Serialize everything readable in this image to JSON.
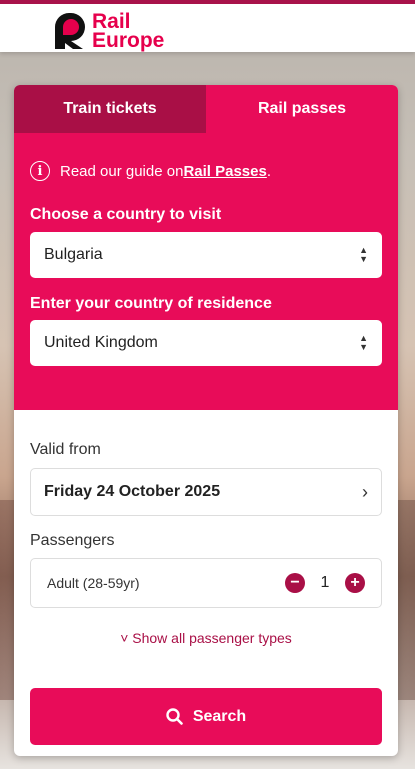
{
  "brand": {
    "line1": "Rail",
    "line2": "Europe",
    "color": "#e6004c"
  },
  "tabs": [
    {
      "label": "Train tickets",
      "active": false
    },
    {
      "label": "Rail passes",
      "active": true
    }
  ],
  "info": {
    "prefix": "Read our guide on ",
    "link": "Rail Passes",
    "suffix": "."
  },
  "country": {
    "label": "Choose a country to visit",
    "value": "Bulgaria"
  },
  "residence": {
    "label": "Enter your country of residence",
    "value": "United Kingdom"
  },
  "valid_from": {
    "label": "Valid from",
    "value": "Friday 24 October 2025"
  },
  "passengers": {
    "label": "Passengers",
    "type": "Adult (28-59yr)",
    "count": "1",
    "minus": "−",
    "plus": "+"
  },
  "show_all": "Show all passenger types",
  "search": {
    "label": "Search"
  },
  "colors": {
    "accent": "#e80c59",
    "dark_accent": "#a90f46"
  }
}
